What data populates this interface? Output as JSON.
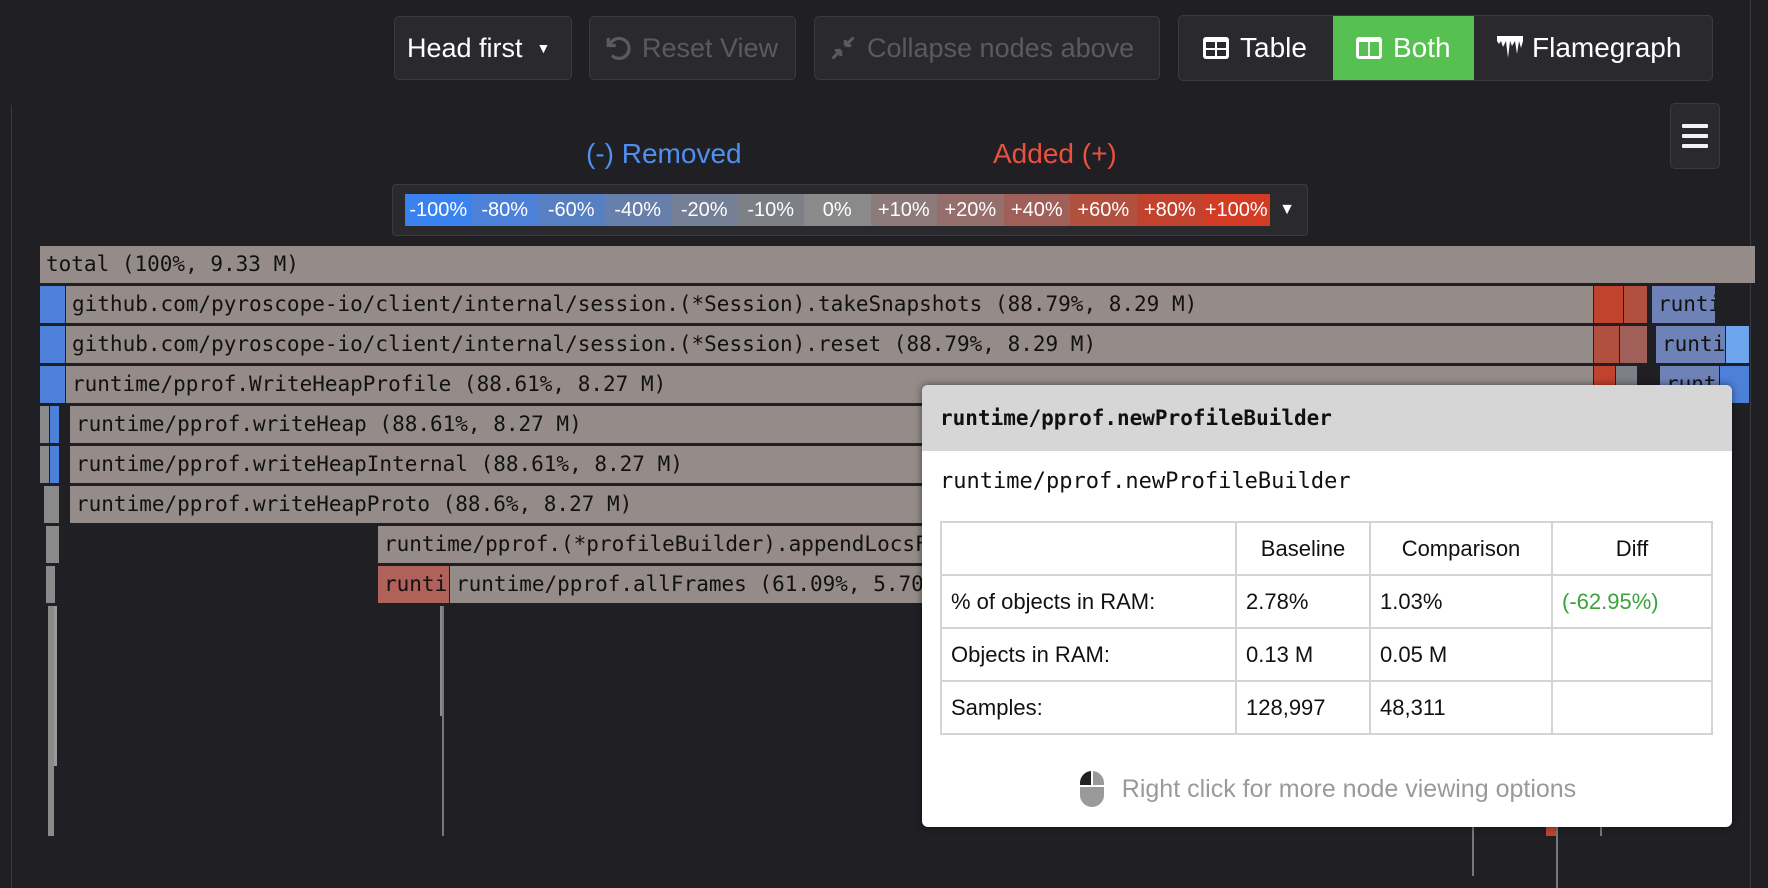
{
  "toolbar": {
    "sort_label": "Head first",
    "reset_label": "Reset View",
    "collapse_label": "Collapse nodes above",
    "view_table": "Table",
    "view_both": "Both",
    "view_flamegraph": "Flamegraph"
  },
  "legend": {
    "removed_label": "(-) Removed",
    "added_label": "Added (+)",
    "removed_color": "#4f8ff0",
    "added_color": "#e9503f",
    "scale": [
      "-100%",
      "-80%",
      "-60%",
      "-40%",
      "-20%",
      "-10%",
      "0%",
      "+10%",
      "+20%",
      "+40%",
      "+60%",
      "+80%",
      "+100%"
    ],
    "scale_colors": [
      "#3a82f0",
      "#4d80d8",
      "#5680c2",
      "#667fab",
      "#757f95",
      "#7e8088",
      "#8a8a8a",
      "#8c7b7a",
      "#956f6c",
      "#a05f58",
      "#b2503f",
      "#c1432e",
      "#d23b24"
    ]
  },
  "flamegraph": {
    "frames": [
      {
        "label": "total (100%, 9.33 M)"
      },
      {
        "label": "github.com/pyroscope-io/client/internal/session.(*Session).takeSnapshots (88.79%, 8.29 M)"
      },
      {
        "label": "github.com/pyroscope-io/client/internal/session.(*Session).reset (88.79%, 8.29 M)"
      },
      {
        "label": "runtime/pprof.WriteHeapProfile (88.61%, 8.27 M)"
      },
      {
        "label": "runtime/pprof.writeHeap (88.61%, 8.27 M)"
      },
      {
        "label": "runtime/pprof.writeHeapInternal (88.61%, 8.27 M)"
      },
      {
        "label": "runtime/pprof.writeHeapProto (88.6%, 8.27 M)"
      },
      {
        "label": "runtime/pprof.(*profileBuilder).appendLocsFo"
      },
      {
        "label": "runti"
      },
      {
        "label": "runtime/pprof.allFrames (61.09%, 5.70 M)"
      },
      {
        "label": "runtime/"
      },
      {
        "label": "runti"
      },
      {
        "label": "runti"
      }
    ]
  },
  "tooltip": {
    "title": "runtime/pprof.newProfileBuilder",
    "subtitle": "runtime/pprof.newProfileBuilder",
    "columns": [
      "",
      "Baseline",
      "Comparison",
      "Diff"
    ],
    "rows": [
      {
        "label": "% of objects in RAM:",
        "baseline": "2.78%",
        "comparison": "1.03%",
        "diff": "(-62.95%)"
      },
      {
        "label": "Objects in RAM:",
        "baseline": "0.13 M",
        "comparison": "0.05 M",
        "diff": ""
      },
      {
        "label": "Samples:",
        "baseline": "128,997",
        "comparison": "48,311",
        "diff": ""
      }
    ],
    "diff_color": "#3aa33a",
    "hint": "Right click for more node viewing options"
  }
}
